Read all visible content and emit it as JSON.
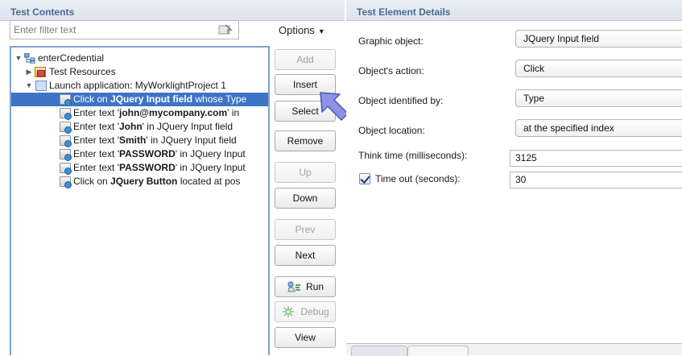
{
  "left": {
    "title": "Test Contents",
    "filter_placeholder": "Enter filter text",
    "options_label": "Options",
    "tree": [
      {
        "text": "enterCredential",
        "bold": ""
      },
      {
        "text": "Test Resources",
        "bold": ""
      },
      {
        "text": "Launch application: MyWorklightProject  1",
        "bold": ""
      },
      {
        "pre": "Click on ",
        "bold": "JQuery Input field",
        "post": " whose Type",
        "selected": true
      },
      {
        "pre": "Enter text '",
        "bold": "john@mycompany.com",
        "post": "' in"
      },
      {
        "pre": "Enter text '",
        "bold": "John",
        "post": "' in JQuery Input field"
      },
      {
        "pre": "Enter text '",
        "bold": "Smith",
        "post": "' in JQuery Input field"
      },
      {
        "pre": "Enter text '",
        "bold": "PASSWORD",
        "post": "' in JQuery Input"
      },
      {
        "pre": "Enter text '",
        "bold": "PASSWORD",
        "post": "' in JQuery Input"
      },
      {
        "pre": "Click on ",
        "bold": "JQuery Button",
        "post": " located at pos"
      }
    ],
    "buttons": {
      "add": "Add",
      "insert": "Insert",
      "select": "Select",
      "remove": "Remove",
      "up": "Up",
      "down": "Down",
      "prev": "Prev",
      "next": "Next",
      "run": "Run",
      "debug": "Debug",
      "view": "View"
    }
  },
  "right": {
    "title": "Test Element Details",
    "graphic_object_label": "Graphic object:",
    "graphic_object_value": "JQuery Input field",
    "action_label": "Object's action:",
    "action_value": "Click",
    "identified_label": "Object identified by:",
    "identified_value": "Type",
    "location_label": "Object location:",
    "location_value": "at the specified index",
    "think_label": "Think time (milliseconds):",
    "think_value": "3125",
    "timeout_label": "Time out (seconds):",
    "timeout_value": "30",
    "timeout_checked": true
  },
  "colors": {
    "selection": "#3d74c6",
    "header_title": "#4a6a93",
    "pointer_arrow": "#8a93e6"
  }
}
